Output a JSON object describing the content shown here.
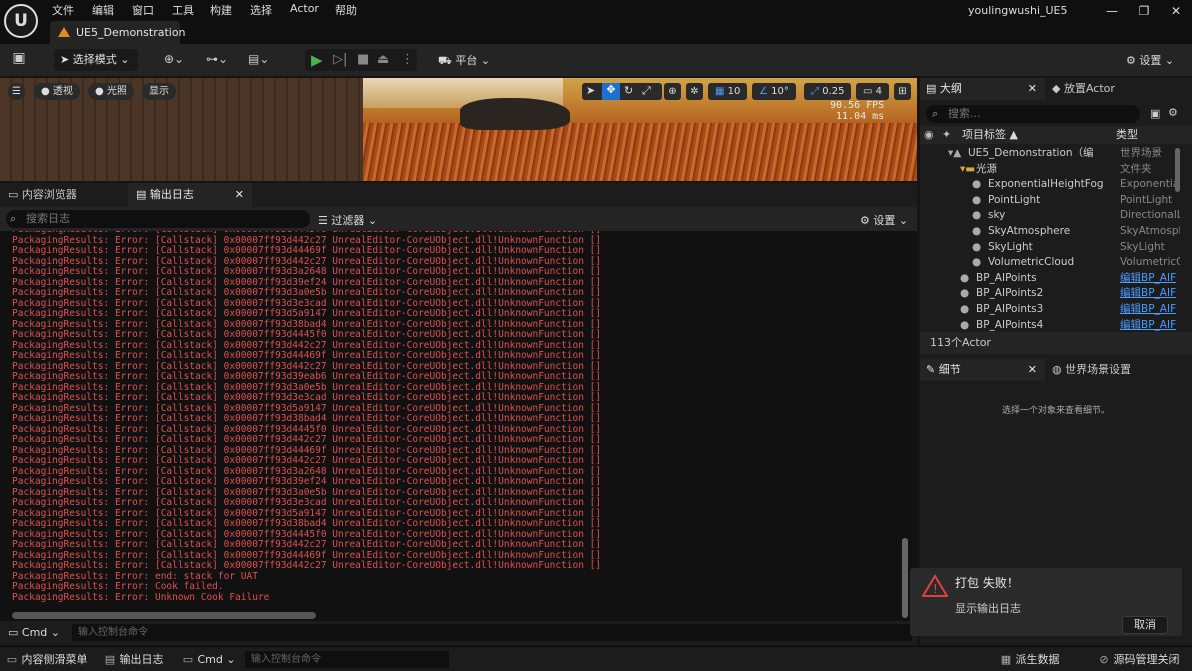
{
  "titlebar": {
    "logo": "U",
    "menus": [
      "文件",
      "编辑",
      "窗口",
      "工具",
      "构建",
      "选择",
      "Actor",
      "帮助"
    ],
    "doc_tab": "UE5_Demonstration",
    "user": "youlingwushi_UE5",
    "win_min": "—",
    "win_max": "❐",
    "win_close": "✕"
  },
  "toolbar": {
    "mode": "选择模式",
    "platform": "平台",
    "settings": "设置"
  },
  "viewport": {
    "perspective": "透视",
    "lighting": "光照",
    "show": "显示",
    "grid": "10",
    "angle": "10°",
    "scale": "0.25",
    "cam": "4",
    "fps": "90.56 FPS",
    "ms": "11.04 ms"
  },
  "panel_tabs": {
    "content": "内容浏览器",
    "output": "输出日志"
  },
  "log": {
    "search_placeholder": "搜索日志",
    "filters": "过滤器",
    "settings": "设置",
    "lines": [
      "PackagingResults: Error: [Callstack] 0x00007ff93d4445f0 UnrealEditor-CoreUObject.dll!UnknownFunction []",
      "PackagingResults: Error: [Callstack] 0x00007ff93d442c27 UnrealEditor-CoreUObject.dll!UnknownFunction []",
      "PackagingResults: Error: [Callstack] 0x00007ff93d44469f UnrealEditor-CoreUObject.dll!UnknownFunction []",
      "PackagingResults: Error: [Callstack] 0x00007ff93d442c27 UnrealEditor-CoreUObject.dll!UnknownFunction []",
      "PackagingResults: Error: [Callstack] 0x00007ff93d3a2648 UnrealEditor-CoreUObject.dll!UnknownFunction []",
      "PackagingResults: Error: [Callstack] 0x00007ff93d39ef24 UnrealEditor-CoreUObject.dll!UnknownFunction []",
      "PackagingResults: Error: [Callstack] 0x00007ff93d3a0e5b UnrealEditor-CoreUObject.dll!UnknownFunction []",
      "PackagingResults: Error: [Callstack] 0x00007ff93d3e3cad UnrealEditor-CoreUObject.dll!UnknownFunction []",
      "PackagingResults: Error: [Callstack] 0x00007ff93d5a9147 UnrealEditor-CoreUObject.dll!UnknownFunction []",
      "PackagingResults: Error: [Callstack] 0x00007ff93d38bad4 UnrealEditor-CoreUObject.dll!UnknownFunction []",
      "PackagingResults: Error: [Callstack] 0x00007ff93d4445f0 UnrealEditor-CoreUObject.dll!UnknownFunction []",
      "PackagingResults: Error: [Callstack] 0x00007ff93d442c27 UnrealEditor-CoreUObject.dll!UnknownFunction []",
      "PackagingResults: Error: [Callstack] 0x00007ff93d44469f UnrealEditor-CoreUObject.dll!UnknownFunction []",
      "PackagingResults: Error: [Callstack] 0x00007ff93d442c27 UnrealEditor-CoreUObject.dll!UnknownFunction []",
      "PackagingResults: Error: [Callstack] 0x00007ff93d39eab6 UnrealEditor-CoreUObject.dll!UnknownFunction []",
      "PackagingResults: Error: [Callstack] 0x00007ff93d3a0e5b UnrealEditor-CoreUObject.dll!UnknownFunction []",
      "PackagingResults: Error: [Callstack] 0x00007ff93d3e3cad UnrealEditor-CoreUObject.dll!UnknownFunction []",
      "PackagingResults: Error: [Callstack] 0x00007ff93d5a9147 UnrealEditor-CoreUObject.dll!UnknownFunction []",
      "PackagingResults: Error: [Callstack] 0x00007ff93d38bad4 UnrealEditor-CoreUObject.dll!UnknownFunction []",
      "PackagingResults: Error: [Callstack] 0x00007ff93d4445f0 UnrealEditor-CoreUObject.dll!UnknownFunction []",
      "PackagingResults: Error: [Callstack] 0x00007ff93d442c27 UnrealEditor-CoreUObject.dll!UnknownFunction []",
      "PackagingResults: Error: [Callstack] 0x00007ff93d44469f UnrealEditor-CoreUObject.dll!UnknownFunction []",
      "PackagingResults: Error: [Callstack] 0x00007ff93d442c27 UnrealEditor-CoreUObject.dll!UnknownFunction []",
      "PackagingResults: Error: [Callstack] 0x00007ff93d3a2648 UnrealEditor-CoreUObject.dll!UnknownFunction []",
      "PackagingResults: Error: [Callstack] 0x00007ff93d39ef24 UnrealEditor-CoreUObject.dll!UnknownFunction []",
      "PackagingResults: Error: [Callstack] 0x00007ff93d3a0e5b UnrealEditor-CoreUObject.dll!UnknownFunction []",
      "PackagingResults: Error: [Callstack] 0x00007ff93d3e3cad UnrealEditor-CoreUObject.dll!UnknownFunction []",
      "PackagingResults: Error: [Callstack] 0x00007ff93d5a9147 UnrealEditor-CoreUObject.dll!UnknownFunction []",
      "PackagingResults: Error: [Callstack] 0x00007ff93d38bad4 UnrealEditor-CoreUObject.dll!UnknownFunction []",
      "PackagingResults: Error: [Callstack] 0x00007ff93d4445f0 UnrealEditor-CoreUObject.dll!UnknownFunction []",
      "PackagingResults: Error: [Callstack] 0x00007ff93d442c27 UnrealEditor-CoreUObject.dll!UnknownFunction []",
      "PackagingResults: Error: [Callstack] 0x00007ff93d44469f UnrealEditor-CoreUObject.dll!UnknownFunction []",
      "PackagingResults: Error: [Callstack] 0x00007ff93d442c27 UnrealEditor-CoreUObject.dll!UnknownFunction []",
      "PackagingResults: Error: end: stack for UAT",
      "PackagingResults: Error: Cook failed.",
      "PackagingResults: Error: Unknown Cook Failure"
    ]
  },
  "cmd": {
    "label": "Cmd",
    "placeholder": "输入控制台命令"
  },
  "outliner": {
    "tab": "大纲",
    "place_actor": "放置Actor",
    "search_placeholder": "搜索...",
    "col_label": "项目标签 ▲",
    "col_type": "类型",
    "rows": [
      {
        "label": "UE5_Demonstration（编",
        "type": "世界场景",
        "indent": 0,
        "link": false
      },
      {
        "label": "光源",
        "type": "文件夹",
        "indent": 1,
        "link": false
      },
      {
        "label": "ExponentialHeightFog",
        "type": "Exponential",
        "indent": 2,
        "link": false
      },
      {
        "label": "PointLight",
        "type": "PointLight",
        "indent": 2,
        "link": false
      },
      {
        "label": "sky",
        "type": "DirectionalL",
        "indent": 2,
        "link": false
      },
      {
        "label": "SkyAtmosphere",
        "type": "SkyAtmosph",
        "indent": 2,
        "link": false
      },
      {
        "label": "SkyLight",
        "type": "SkyLight",
        "indent": 2,
        "link": false
      },
      {
        "label": "VolumetricCloud",
        "type": "VolumetricC",
        "indent": 2,
        "link": false
      },
      {
        "label": "BP_AIPoints",
        "type": "编辑BP_AIF",
        "indent": 1,
        "link": true
      },
      {
        "label": "BP_AIPoints2",
        "type": "编辑BP_AIF",
        "indent": 1,
        "link": true
      },
      {
        "label": "BP_AIPoints3",
        "type": "编辑BP_AIF",
        "indent": 1,
        "link": true
      },
      {
        "label": "BP_AIPoints4",
        "type": "编辑BP_AIF",
        "indent": 1,
        "link": true
      }
    ],
    "count": "113个Actor"
  },
  "details": {
    "tab": "细节",
    "world_settings": "世界场景设置",
    "empty": "选择一个对象来查看细节。"
  },
  "toast": {
    "title": "打包 失败！",
    "link": "显示输出日志",
    "cancel": "取消"
  },
  "statusbar": {
    "drawer": "内容侧滑菜单",
    "output": "输出日志",
    "cmd": "Cmd",
    "cmd_placeholder": "输入控制台命令",
    "derived": "派生数据",
    "source_control": "源码管理关闭"
  },
  "colors": {
    "error_text": "#e05050",
    "link": "#4a9eff",
    "play_green": "#4caf50",
    "warning_red": "#e04040"
  }
}
